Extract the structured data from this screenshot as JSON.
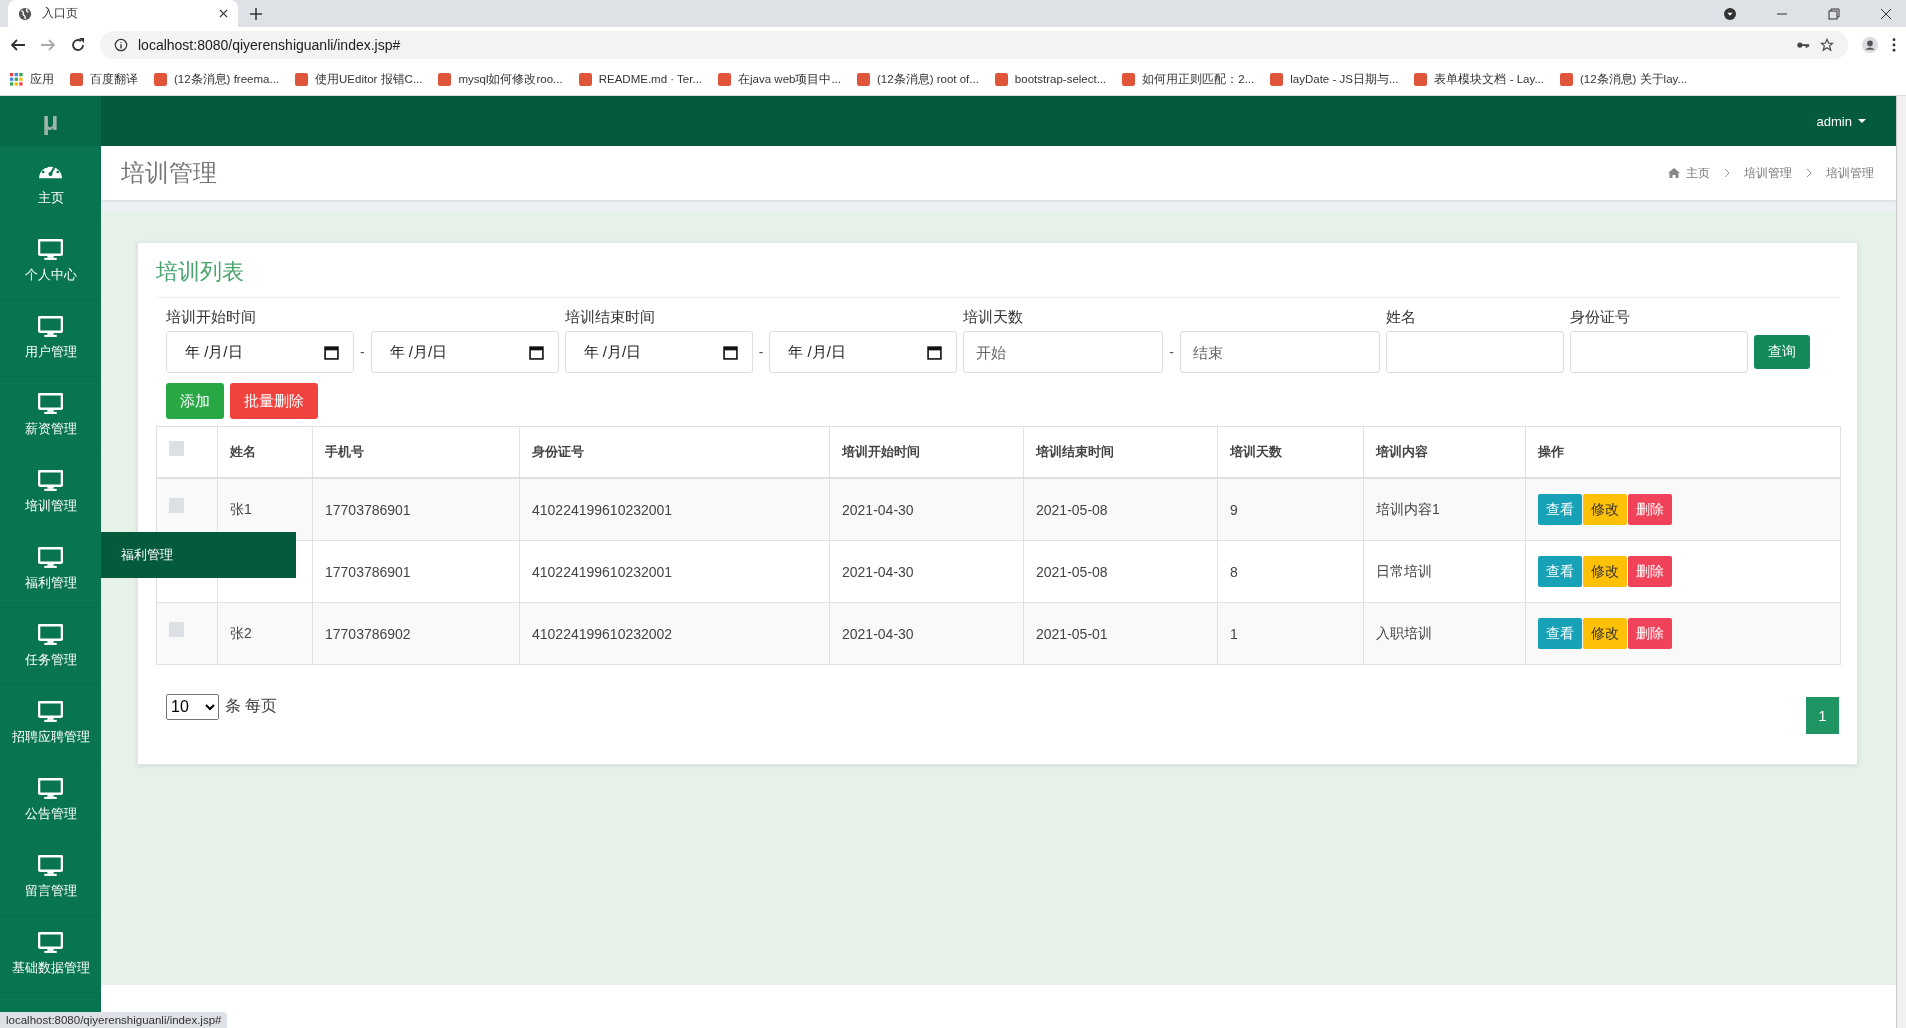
{
  "browser": {
    "tab_title": "入口页",
    "url": "localhost:8080/qiyerenshiguanli/index.jsp#",
    "bookmarks": [
      {
        "label": "应用"
      },
      {
        "label": "百度翻译"
      },
      {
        "label": "(12条消息) freema..."
      },
      {
        "label": "使用UEditor 报错C..."
      },
      {
        "label": "mysql如何修改roo..."
      },
      {
        "label": "README.md · Ter..."
      },
      {
        "label": "在java web项目中..."
      },
      {
        "label": "(12条消息) root of..."
      },
      {
        "label": "bootstrap-select..."
      },
      {
        "label": "如何用正则匹配：2..."
      },
      {
        "label": "layDate - JS日期与..."
      },
      {
        "label": "表单模块文档 - Lay..."
      },
      {
        "label": "(12条消息) 关于lay..."
      }
    ]
  },
  "header": {
    "user": "admin"
  },
  "sidebar": {
    "logo": "μ",
    "items": [
      {
        "label": "主页",
        "kind": "dashboard"
      },
      {
        "label": "个人中心",
        "kind": "monitor"
      },
      {
        "label": "用户管理",
        "kind": "monitor"
      },
      {
        "label": "薪资管理",
        "kind": "monitor"
      },
      {
        "label": "培训管理",
        "kind": "monitor"
      },
      {
        "label": "福利管理",
        "kind": "monitor"
      },
      {
        "label": "任务管理",
        "kind": "monitor"
      },
      {
        "label": "招聘应聘管理",
        "kind": "monitor"
      },
      {
        "label": "公告管理",
        "kind": "monitor"
      },
      {
        "label": "留言管理",
        "kind": "monitor"
      },
      {
        "label": "基础数据管理",
        "kind": "monitor"
      }
    ]
  },
  "tooltip": "福利管理",
  "page_title": "培训管理",
  "breadcrumb": [
    "主页",
    "培训管理",
    "培训管理"
  ],
  "card_title": "培训列表",
  "filters": [
    {
      "label": "培训开始时间",
      "separator": "-",
      "inputs": [
        {
          "kind": "date",
          "value": "年 /月/日"
        },
        {
          "kind": "date",
          "value": "年 /月/日"
        }
      ]
    },
    {
      "label": "培训结束时间",
      "separator": "-",
      "inputs": [
        {
          "kind": "date",
          "value": "年 /月/日"
        },
        {
          "kind": "date",
          "value": "年 /月/日"
        }
      ]
    },
    {
      "label": "培训天数",
      "separator": "-",
      "inputs": [
        {
          "kind": "text",
          "placeholder": "开始"
        },
        {
          "kind": "text",
          "placeholder": "结束"
        }
      ]
    },
    {
      "label": "姓名",
      "inputs": [
        {
          "kind": "text"
        }
      ]
    },
    {
      "label": "身份证号",
      "inputs": [
        {
          "kind": "text"
        }
      ]
    }
  ],
  "search_button": "查询",
  "add_button": "添加",
  "batch_delete_button": "批量删除",
  "table": {
    "columns": [
      "姓名",
      "手机号",
      "身份证号",
      "培训开始时间",
      "培训结束时间",
      "培训天数",
      "培训内容",
      "操作"
    ],
    "header_checkbox": {
      "checked": false
    },
    "rows": [
      {
        "checked": false,
        "cells": [
          "张1",
          "17703786901",
          "410224199610232001",
          "2021-04-30",
          "2021-05-08",
          "9",
          "培训内容1"
        ],
        "actions": [
          "查看",
          "修改",
          "删除"
        ]
      },
      {
        "cells": [
          "",
          "17703786901",
          "410224199610232001",
          "2021-04-30",
          "2021-05-08",
          "8",
          "日常培训"
        ],
        "actions": [
          "查看",
          "修改",
          "删除"
        ]
      },
      {
        "checked": false,
        "cells": [
          "张2",
          "17703786902",
          "410224199610232002",
          "2021-04-30",
          "2021-05-01",
          "1",
          "入职培训"
        ],
        "actions": [
          "查看",
          "修改",
          "删除"
        ]
      }
    ]
  },
  "pager": {
    "page_size": "10",
    "per_page_label": "条 每页",
    "pages": [
      {
        "label": "1",
        "selected": true
      }
    ]
  },
  "status_bar": "localhost:8080/qiyerenshiguanli/index.jsp#"
}
